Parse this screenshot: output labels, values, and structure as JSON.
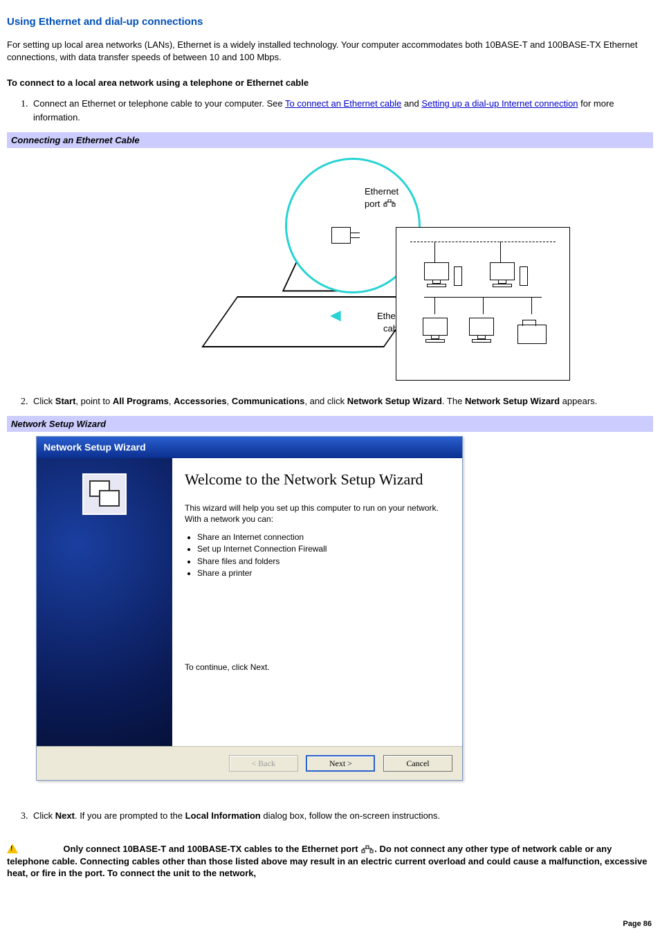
{
  "title": "Using Ethernet and dial-up connections",
  "intro": "For setting up local area networks (LANs), Ethernet is a widely installed technology. Your computer accommodates both 10BASE-T and 100BASE-TX Ethernet connections, with data transfer speeds of between 10 and 100 Mbps.",
  "subheading": "To connect to a local area network using a telephone or Ethernet cable",
  "step1_a": "Connect an Ethernet or telephone cable to your computer. See ",
  "step1_link1": "To connect an Ethernet cable",
  "step1_b": " and ",
  "step1_link2": "Setting up a dial-up Internet connection",
  "step1_c": " for more information.",
  "band1": "Connecting an Ethernet Cable",
  "fig1": {
    "port_label": "Ethernet\nport",
    "cable_label": "Ethernet\ncable"
  },
  "step2_a": "Click ",
  "step2_start": "Start",
  "step2_b": ", point to ",
  "step2_allprog": "All Programs",
  "step2_c": ", ",
  "step2_acc": "Accessories",
  "step2_d": ", ",
  "step2_comm": "Communications",
  "step2_e": ", and click ",
  "step2_nsw": "Network Setup Wizard",
  "step2_f": ". The ",
  "step2_nsw2": "Network Setup Wizard",
  "step2_g": " appears.",
  "band2": "Network Setup Wizard",
  "wizard": {
    "titlebar": "Network Setup Wizard",
    "heading": "Welcome to the Network Setup Wizard",
    "desc": "This wizard will help you set up this computer to run on your network. With a network you can:",
    "bullets": [
      "Share an Internet connection",
      "Set up Internet Connection Firewall",
      "Share files and folders",
      "Share a printer"
    ],
    "continue": "To continue, click Next.",
    "btn_back": "< Back",
    "btn_next": "Next >",
    "btn_cancel": "Cancel"
  },
  "step3_a": "Click ",
  "step3_next": "Next",
  "step3_b": ". If you are prompted to the ",
  "step3_local": "Local Information",
  "step3_c": " dialog box, follow the on-screen instructions.",
  "warning_a": "Only connect 10BASE-T and 100BASE-TX cables to the Ethernet port ",
  "warning_b": ". Do not connect any other type of network cable or any telephone cable. Connecting cables other than those listed above may result in an electric current overload and could cause a malfunction, excessive heat, or fire in the port. To connect the unit to the network,",
  "page": "Page 86"
}
